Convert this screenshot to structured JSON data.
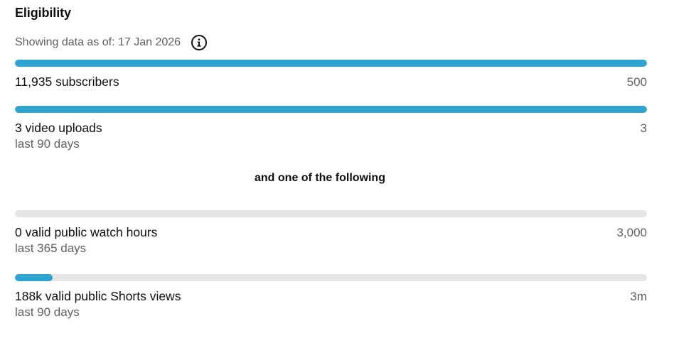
{
  "header": {
    "title": "Eligibility",
    "as_of_text": "Showing data as of: 17 Jan 2026",
    "info_icon": "info-circle-icon"
  },
  "accent_color": "#2fa4cf",
  "track_color": "#e5e5e5",
  "divider": {
    "text": "and one of the following"
  },
  "metrics": [
    {
      "label": "11,935 subscribers",
      "target": "500",
      "sublabel": "",
      "progress": 1.0
    },
    {
      "label": "3 video uploads",
      "target": "3",
      "sublabel": "last 90 days",
      "progress": 1.0
    },
    {
      "label": "0 valid public watch hours",
      "target": "3,000",
      "sublabel": "last 365 days",
      "progress": 0.0
    },
    {
      "label": "188k valid public Shorts views",
      "target": "3m",
      "sublabel": "last 90 days",
      "progress": 0.06
    }
  ]
}
